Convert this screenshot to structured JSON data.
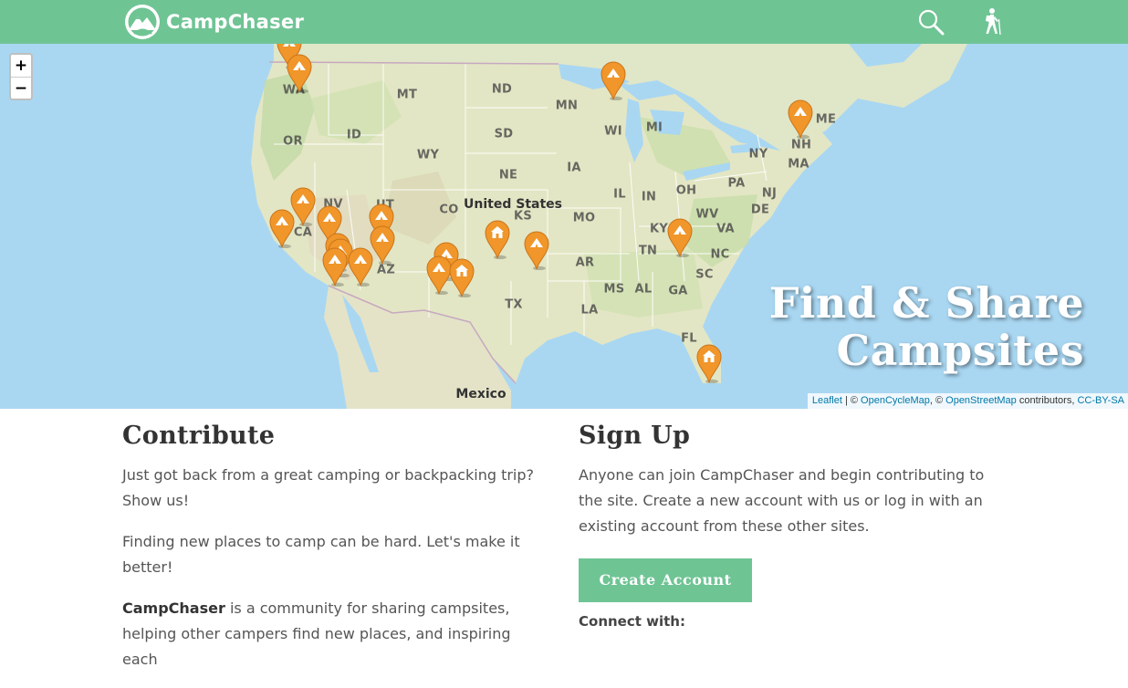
{
  "header": {
    "brand_name": "CampChaser",
    "icons": [
      "mountain-logo-icon",
      "search-icon",
      "hiker-icon"
    ]
  },
  "map": {
    "zoom_in_label": "+",
    "zoom_out_label": "−",
    "hero_line1": "Find & Share",
    "hero_line2": "Campsites",
    "country_labels": {
      "us": "United States",
      "mexico": "Mexico"
    },
    "state_labels": [
      "WA",
      "MT",
      "ND",
      "MN",
      "OR",
      "ID",
      "SD",
      "WI",
      "MI",
      "ME",
      "WY",
      "NE",
      "IA",
      "NY",
      "NH",
      "MA",
      "NV",
      "UT",
      "CO",
      "KS",
      "IL",
      "IN",
      "OH",
      "PA",
      "NJ",
      "CA",
      "MO",
      "KY",
      "WV",
      "VA",
      "DE",
      "TN",
      "NC",
      "AZ",
      "AR",
      "SC",
      "TX",
      "MS",
      "AL",
      "GA",
      "LA",
      "FL"
    ],
    "marker_icons": [
      "tent-icon",
      "cabin-icon"
    ],
    "attribution": {
      "leaflet": "Leaflet",
      "sep1": " | © ",
      "opencyclemap": "OpenCycleMap",
      "sep2": ", © ",
      "openstreetmap": "OpenStreetMap",
      "sep3": " contributors, ",
      "license": "CC-BY-SA"
    }
  },
  "contribute": {
    "title": "Contribute",
    "p1": "Just got back from a great camping or backpacking trip? Show us!",
    "p2": "Finding new places to camp can be hard. Let's make it better!",
    "p3_brand": "CampChaser",
    "p3_rest": " is a community for sharing campsites, helping other campers find new places, and inspiring each"
  },
  "signup": {
    "title": "Sign Up",
    "p1": "Anyone can join CampChaser and begin contributing to the site. Create a new account with us or log in with an existing account from these other sites.",
    "button_label": "Create Account",
    "connect_label": "Connect with:"
  },
  "colors": {
    "brand_green": "#6fc494",
    "marker_orange": "#f0962a",
    "water": "#a9d7f2",
    "land": "#e2e6c6",
    "link_blue": "#0078a8"
  }
}
